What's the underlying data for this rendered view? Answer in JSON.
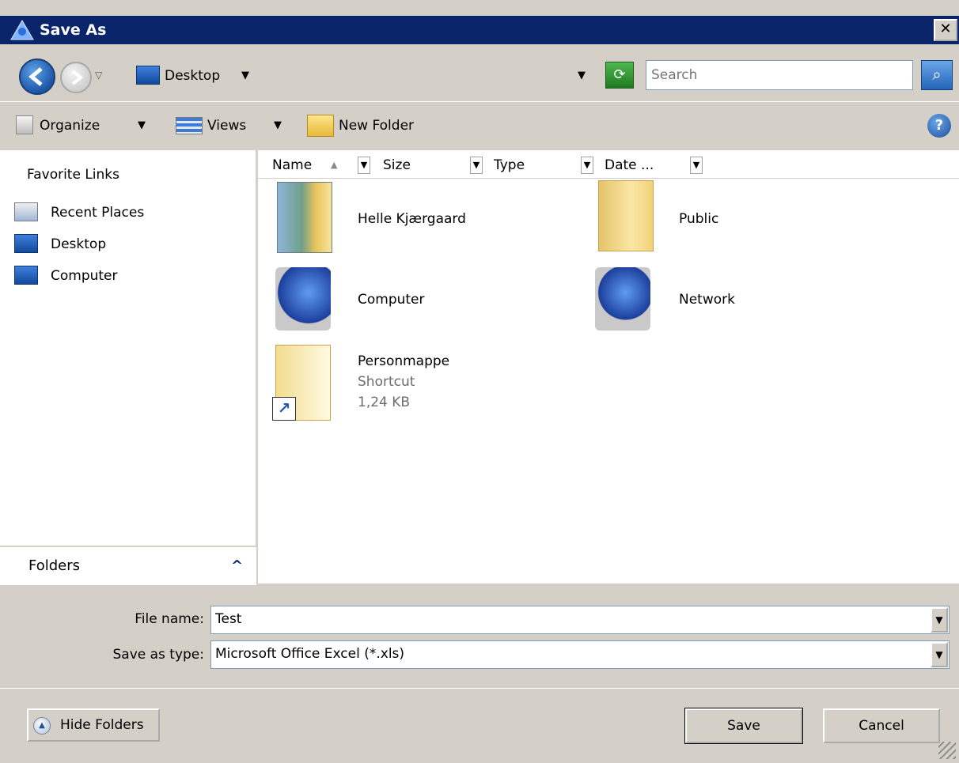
{
  "window": {
    "title": "Save As",
    "close_glyph": "✕"
  },
  "address": {
    "location": "Desktop",
    "search_placeholder": "Search",
    "refresh_glyph": "⟳",
    "search_glyph": "⌕"
  },
  "toolbar": {
    "organize_label": "Organize",
    "views_label": "Views",
    "new_folder_label": "New Folder",
    "help_glyph": "?"
  },
  "favorites": {
    "title": "Favorite Links",
    "items": [
      {
        "label": "Recent Places",
        "icon": "recent-places-icon"
      },
      {
        "label": "Desktop",
        "icon": "desktop-icon"
      },
      {
        "label": "Computer",
        "icon": "computer-icon"
      }
    ]
  },
  "folders": {
    "label": "Folders",
    "toggle_glyph": "^"
  },
  "columns": [
    "Name",
    "Size",
    "Type",
    "Date ..."
  ],
  "items": [
    {
      "name": "Helle Kjærgaard",
      "icon": "user-folder-icon"
    },
    {
      "name": "Public",
      "icon": "folder-icon"
    },
    {
      "name": "Computer",
      "icon": "computer-icon"
    },
    {
      "name": "Network",
      "icon": "network-icon"
    },
    {
      "name": "Personmappe",
      "type": "Shortcut",
      "size": "1,24 KB",
      "icon": "shortcut-icon"
    }
  ],
  "fields": {
    "file_name_label": "File name:",
    "file_name_value": "Test",
    "save_as_type_label": "Save as type:",
    "save_as_type_value": "Microsoft Office Excel (*.xls)"
  },
  "buttons": {
    "hide_folders": "Hide Folders",
    "save": "Save",
    "cancel": "Cancel"
  }
}
